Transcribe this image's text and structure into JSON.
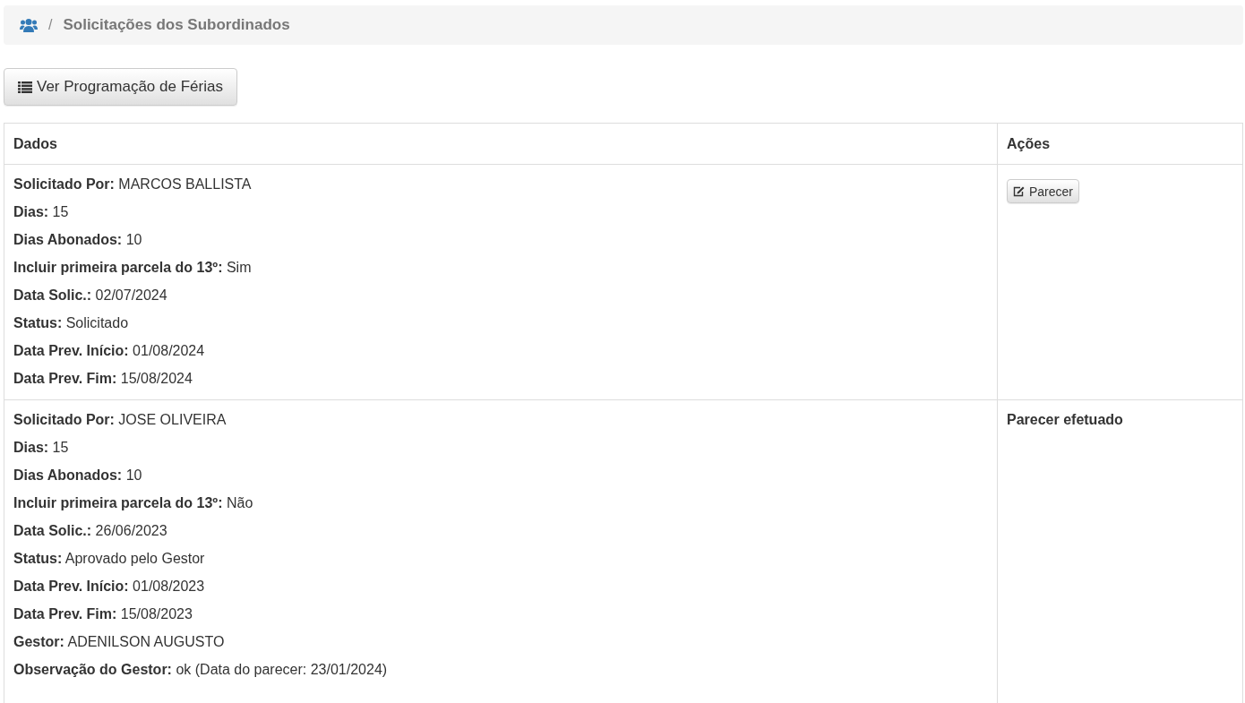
{
  "breadcrumb": {
    "separator": "/",
    "title": "Solicitações dos Subordinados"
  },
  "toolbar": {
    "button": "Ver Programação de Férias"
  },
  "table": {
    "columns": [
      "Dados",
      "Ações"
    ],
    "rows": [
      {
        "fields": [
          {
            "label": "Solicitado Por:",
            "value": "MARCOS BALLISTA"
          },
          {
            "label": "Dias:",
            "value": "15"
          },
          {
            "label": "Dias Abonados:",
            "value": "10"
          },
          {
            "label": "Incluir primeira parcela do 13º:",
            "value": "Sim"
          },
          {
            "label": "Data Solic.:",
            "value": "02/07/2024"
          },
          {
            "label": "Status:",
            "value": "Solicitado"
          },
          {
            "label": "Data Prev. Início:",
            "value": "01/08/2024"
          },
          {
            "label": "Data Prev. Fim:",
            "value": "15/08/2024"
          }
        ],
        "action": {
          "kind": "button",
          "text": "Parecer"
        }
      },
      {
        "fields": [
          {
            "label": "Solicitado Por:",
            "value": "JOSE OLIVEIRA"
          },
          {
            "label": "Dias:",
            "value": "15"
          },
          {
            "label": "Dias Abonados:",
            "value": "10"
          },
          {
            "label": "Incluir primeira parcela do 13º:",
            "value": "Não"
          },
          {
            "label": "Data Solic.:",
            "value": "26/06/2023"
          },
          {
            "label": "Status:",
            "value": "Aprovado pelo Gestor"
          },
          {
            "label": "Data Prev. Início:",
            "value": "01/08/2023"
          },
          {
            "label": "Data Prev. Fim:",
            "value": "15/08/2023"
          },
          {
            "label": "Gestor:",
            "value": "ADENILSON AUGUSTO"
          },
          {
            "label": "Observação do Gestor:",
            "value": "ok (Data do parecer: 23/01/2024)"
          }
        ],
        "action": {
          "kind": "text",
          "text": "Parecer efetuado"
        }
      }
    ]
  }
}
